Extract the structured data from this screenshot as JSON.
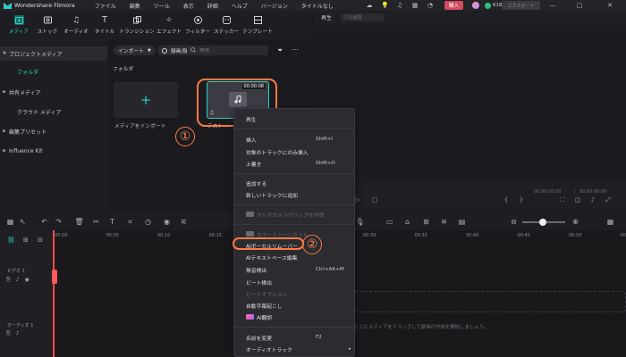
{
  "app": {
    "name": "Wondershare Filmora",
    "menu": [
      "ファイル",
      "編集",
      "ツール",
      "表示",
      "詳細",
      "ヘルプ",
      "バージョン",
      "タイトルなし"
    ],
    "purchase_label": "購入",
    "credits": "618",
    "export_label": "エクスポート"
  },
  "toolbar_tabs": [
    {
      "label": "メディア",
      "icon": "media-icon"
    },
    {
      "label": "ストック",
      "icon": "stock-icon"
    },
    {
      "label": "オーディオ",
      "icon": "music-icon"
    },
    {
      "label": "タイトル",
      "icon": "title-icon"
    },
    {
      "label": "トランジション",
      "icon": "transition-icon"
    },
    {
      "label": "エフェクト",
      "icon": "effect-icon"
    },
    {
      "label": "フィルター",
      "icon": "filter-icon"
    },
    {
      "label": "ステッカー",
      "icon": "sticker-icon"
    },
    {
      "label": "テンプレート",
      "icon": "template-icon"
    }
  ],
  "sidebar": {
    "items": [
      {
        "label": "プロジェクトメディア"
      },
      {
        "label": "フォルダ"
      },
      {
        "label": "共有メディア"
      },
      {
        "label": "クラウド メディア"
      },
      {
        "label": "編集プリセット"
      },
      {
        "label": "Influence Kit"
      }
    ]
  },
  "media": {
    "import_btn": "インポート",
    "record_btn": "録画/録音",
    "search_placeholder": "検索",
    "folder_label": "フォルダ",
    "import_tile_label": "メディアをインポート",
    "clip_duration": "00:00:08",
    "clip_name": "テスト"
  },
  "player": {
    "tab": "再生",
    "quality": "フル画質",
    "time_current": "00:00:00:00",
    "time_total": "00:00:00:00"
  },
  "timeline": {
    "ticks": [
      "00:00",
      "00:05",
      "00:10",
      "00:15",
      "00:20",
      "00:25",
      "00:30",
      "00:35",
      "00:40",
      "00:45",
      "00:50",
      "00:55"
    ],
    "video_track": "ビデオ 1",
    "audio_track": "オーディオ 1",
    "drop_hint": "ここにメディアをドラッグして動画の作成を開始しましょう。"
  },
  "context_menu": {
    "items": [
      {
        "label": "再生"
      },
      {
        "label": "挿入",
        "shortcut": "Shift+I"
      },
      {
        "label": "対象のトラックにのみ挿入"
      },
      {
        "label": "上書き",
        "shortcut": "Shift+O"
      },
      {
        "label": "追加する"
      },
      {
        "label": "新しいトラックに追加"
      },
      {
        "label": "マルチカメラクリップを作成"
      },
      {
        "label": "スマートシーンカット"
      },
      {
        "label": "AIボーカルリムーバー"
      },
      {
        "label": "AIテキストベース編集"
      },
      {
        "label": "無音検出",
        "shortcut": "Ctrl+Alt+M"
      },
      {
        "label": "ビート検出"
      },
      {
        "label": "ビートオプション"
      },
      {
        "label": "自動字幕起こし"
      },
      {
        "label": "AI翻訳"
      },
      {
        "label": "名前を変更",
        "shortcut": "F2"
      },
      {
        "label": "オーディオトラック"
      }
    ]
  },
  "callouts": {
    "one": "①",
    "two": "②"
  },
  "colors": {
    "accent": "#2bd0c5",
    "highlight": "#ff7a45",
    "playhead": "#ff4a4a",
    "purchase": "#d34b5c"
  }
}
